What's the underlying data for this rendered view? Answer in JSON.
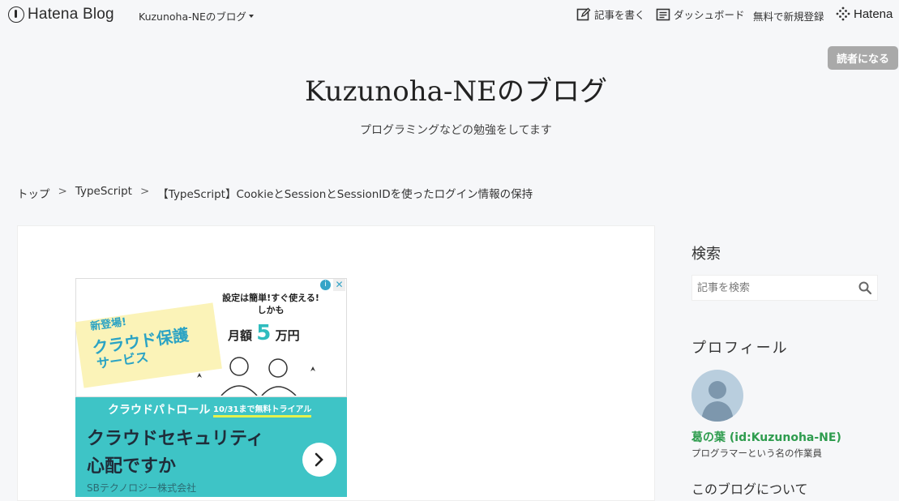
{
  "header": {
    "brand": "Hatena Blog",
    "blog_switch": "Kuzunoha-NEのブログ",
    "write": "記事を書く",
    "dashboard": "ダッシュボード",
    "signup": "無料で新規登録",
    "hatena": "Hatena"
  },
  "subscribe_label": "読者になる",
  "blog": {
    "title": "Kuzunoha-NEのブログ",
    "description": "プログラミングなどの勉強をしてます"
  },
  "breadcrumb": {
    "top": "トップ",
    "sep": ">",
    "category": "TypeScript",
    "current": "【TypeScript】CookieとSessionとSessionIDを使ったログイン情報の保持"
  },
  "ad": {
    "new": "新登場!",
    "service_line1": "クラウド保護",
    "service_line2": "サービス",
    "tag_line1": "設定は簡単!すぐ使える!",
    "tag_line2": "しかも",
    "price_prefix": "月額",
    "price_num": "5",
    "price_suffix": "万円",
    "patrol": "クラウドパトロール",
    "trial": "10/31まで無料トライアル",
    "headline1": "クラウドセキュリティ",
    "headline2": "心配ですか",
    "company": "SBテクノロジー株式会社",
    "info": "i",
    "close": "✕"
  },
  "sidebar": {
    "search_title": "検索",
    "search_placeholder": "記事を検索",
    "profile_title": "プロフィール",
    "profile_name": "葛の葉 (id:Kuzunoha-NE)",
    "profile_desc": "プログラマーという名の作業員",
    "about_title": "このブログについて"
  },
  "colors": {
    "background": "#f6f7f9",
    "subscribe_bg": "#a9a9a9",
    "profile_link": "#2e9c4e",
    "ad_teal": "#3ec4c6",
    "ad_yellow": "#fbf3b8"
  }
}
